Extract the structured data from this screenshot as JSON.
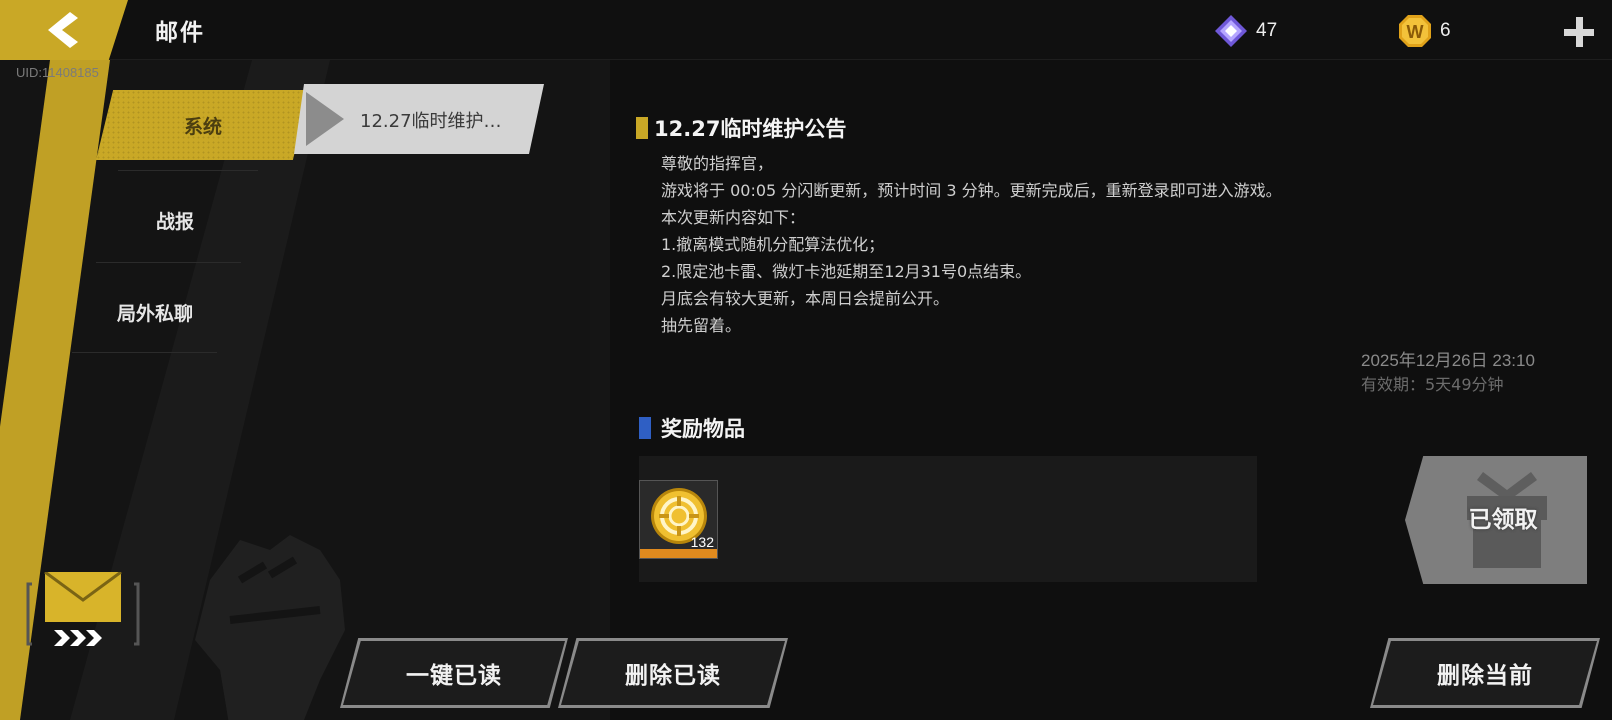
{
  "header": {
    "title": "邮件",
    "uid": "UID:11408185",
    "currencies": [
      {
        "name": "gem",
        "value": "47",
        "icon": "gem-icon",
        "color": "#9b84f0"
      },
      {
        "name": "coin",
        "value": "6",
        "icon": "w-coin-icon",
        "color": "#e0a21a"
      }
    ]
  },
  "tabs": [
    {
      "label": "系统",
      "active": true
    },
    {
      "label": "战报",
      "active": false
    },
    {
      "label": "局外私聊",
      "active": false
    }
  ],
  "mail_list": [
    {
      "label": "12.27临时维护…",
      "selected": true
    }
  ],
  "mail": {
    "title": "12.27临时维护公告",
    "body": [
      "尊敬的指挥官，",
      "游戏将于 00:05 分闪断更新，预计时间 3 分钟。更新完成后，重新登录即可进入游戏。",
      "本次更新内容如下：",
      "1.撤离模式随机分配算法优化；",
      "2.限定池卡雷、微灯卡池延期至12月31号0点结束。",
      "月底会有较大更新，本周日会提前公开。",
      "抽先留着。"
    ],
    "date": "2025年12月26日  23:10",
    "expiry": "有效期：5天49分钟"
  },
  "rewards": {
    "title": "奖励物品",
    "items": [
      {
        "icon": "gold-target-coin-icon",
        "quantity": "132"
      }
    ],
    "claimed_label": "已领取"
  },
  "buttons": {
    "read_all": "一键已读",
    "delete_read": "删除已读",
    "delete_current": "删除当前"
  },
  "colors": {
    "accent_yellow": "#c9a826",
    "reward_blue": "#2f5fc4",
    "rarity_orange": "#e08a1e"
  }
}
